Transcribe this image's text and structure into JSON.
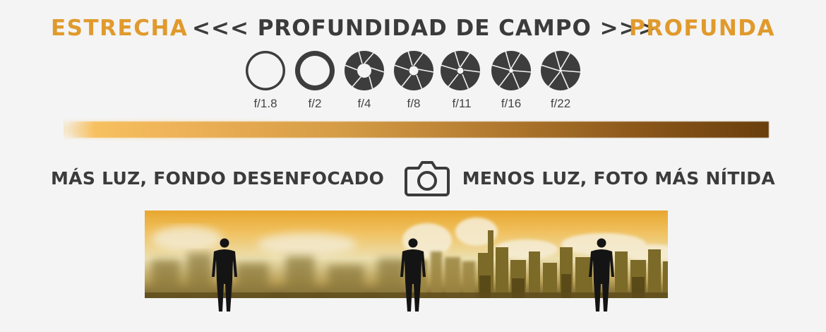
{
  "header": {
    "left_label": "ESTRECHA",
    "center_title": "<<< PROFUNDIDAD DE CAMPO >>>",
    "right_label": "PROFUNDA"
  },
  "apertures": [
    "f/1.8",
    "f/2",
    "f/4",
    "f/8",
    "f/11",
    "f/16",
    "f/22"
  ],
  "captions": {
    "left": "MÁS LUZ, FONDO DESENFOCADO",
    "right": "MENOS LUZ, FOTO MÁS NÍTIDA"
  },
  "colors": {
    "accent": "#e09a2c",
    "text": "#3b3b3b",
    "aperture": "#3d3d3d",
    "gradient_start": "#f7c060",
    "gradient_end": "#6a3f0c",
    "background": "#f4f4f4"
  },
  "icons": {
    "camera": "camera-icon"
  }
}
